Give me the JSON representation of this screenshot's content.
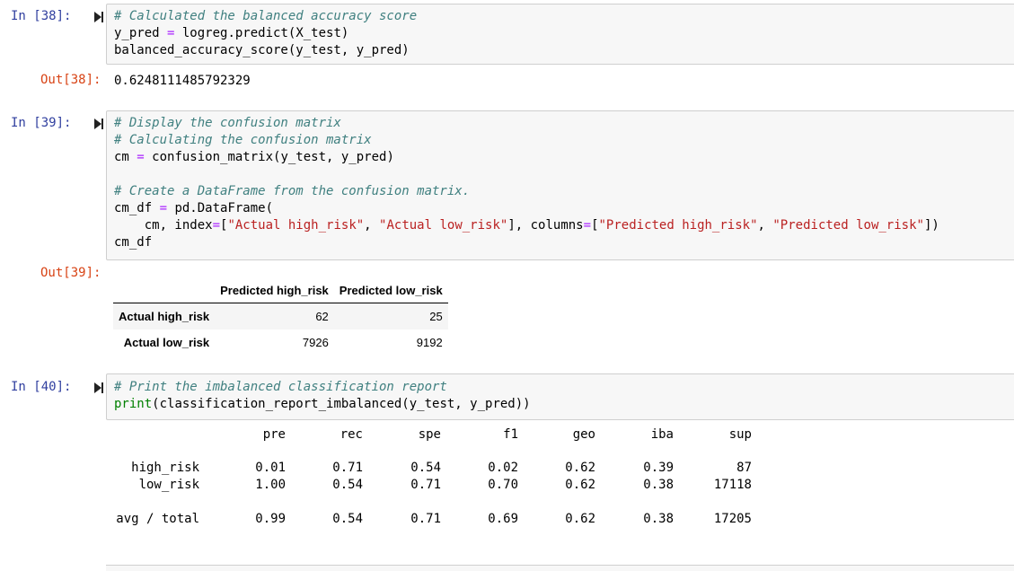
{
  "cells": [
    {
      "in_prompt": "In [38]:",
      "code_lines": [
        [
          {
            "t": "# Calculated the balanced accuracy score",
            "c": "cm"
          }
        ],
        [
          {
            "t": "y_pred ",
            "c": ""
          },
          {
            "t": "=",
            "c": "op"
          },
          {
            "t": " logreg.predict(X_test)",
            "c": ""
          }
        ],
        [
          {
            "t": "balanced_accuracy_score(y_test, y_pred)",
            "c": ""
          }
        ]
      ],
      "out_prompt": "Out[38]:",
      "output": "0.6248111485792329"
    },
    {
      "in_prompt": "In [39]:",
      "code_lines": [
        [
          {
            "t": "# Display the confusion matrix",
            "c": "cm"
          }
        ],
        [
          {
            "t": "# Calculating the confusion matrix",
            "c": "cm"
          }
        ],
        [
          {
            "t": "cm ",
            "c": ""
          },
          {
            "t": "=",
            "c": "op"
          },
          {
            "t": " confusion_matrix(y_test, y_pred)",
            "c": ""
          }
        ],
        [
          {
            "t": "",
            "c": ""
          }
        ],
        [
          {
            "t": "# Create a DataFrame from the confusion matrix.",
            "c": "cm"
          }
        ],
        [
          {
            "t": "cm_df ",
            "c": ""
          },
          {
            "t": "=",
            "c": "op"
          },
          {
            "t": " pd.DataFrame(",
            "c": ""
          }
        ],
        [
          {
            "t": "    cm, index",
            "c": ""
          },
          {
            "t": "=",
            "c": "op"
          },
          {
            "t": "[",
            "c": ""
          },
          {
            "t": "\"Actual high_risk\"",
            "c": "st"
          },
          {
            "t": ", ",
            "c": ""
          },
          {
            "t": "\"Actual low_risk\"",
            "c": "st"
          },
          {
            "t": "], columns",
            "c": ""
          },
          {
            "t": "=",
            "c": "op"
          },
          {
            "t": "[",
            "c": ""
          },
          {
            "t": "\"Predicted high_risk\"",
            "c": "st"
          },
          {
            "t": ", ",
            "c": ""
          },
          {
            "t": "\"Predicted low_risk\"",
            "c": "st"
          },
          {
            "t": "])",
            "c": ""
          }
        ],
        [
          {
            "t": "cm_df",
            "c": ""
          }
        ]
      ],
      "out_prompt": "Out[39]:",
      "table": {
        "columns": [
          "",
          "Predicted high_risk",
          "Predicted low_risk"
        ],
        "rows": [
          {
            "index": "Actual high_risk",
            "values": [
              "62",
              "25"
            ]
          },
          {
            "index": "Actual low_risk",
            "values": [
              "7926",
              "9192"
            ]
          }
        ]
      }
    },
    {
      "in_prompt": "In [40]:",
      "code_lines": [
        [
          {
            "t": "# Print the imbalanced classification report",
            "c": "cm"
          }
        ],
        [
          {
            "t": "print",
            "c": "bi"
          },
          {
            "t": "(classification_report_imbalanced(y_test, y_pred))",
            "c": ""
          }
        ]
      ],
      "report": {
        "headers": [
          "pre",
          "rec",
          "spe",
          "f1",
          "geo",
          "iba",
          "sup"
        ],
        "rows": [
          {
            "label": "high_risk",
            "values": [
              "0.01",
              "0.71",
              "0.54",
              "0.02",
              "0.62",
              "0.39",
              "87"
            ]
          },
          {
            "label": "low_risk",
            "values": [
              "1.00",
              "0.54",
              "0.71",
              "0.70",
              "0.62",
              "0.38",
              "17118"
            ]
          },
          {
            "label": "avg / total",
            "values": [
              "0.99",
              "0.54",
              "0.71",
              "0.69",
              "0.62",
              "0.38",
              "17205"
            ]
          }
        ]
      }
    }
  ],
  "icons": {
    "run": "run-cell-icon"
  },
  "colors": {
    "in_prompt": "#303f9f",
    "out_prompt": "#d84315",
    "cell_bg": "#f7f7f7",
    "comment": "#408080",
    "string": "#ba2121",
    "operator": "#aa22ff",
    "builtin": "#008000"
  }
}
